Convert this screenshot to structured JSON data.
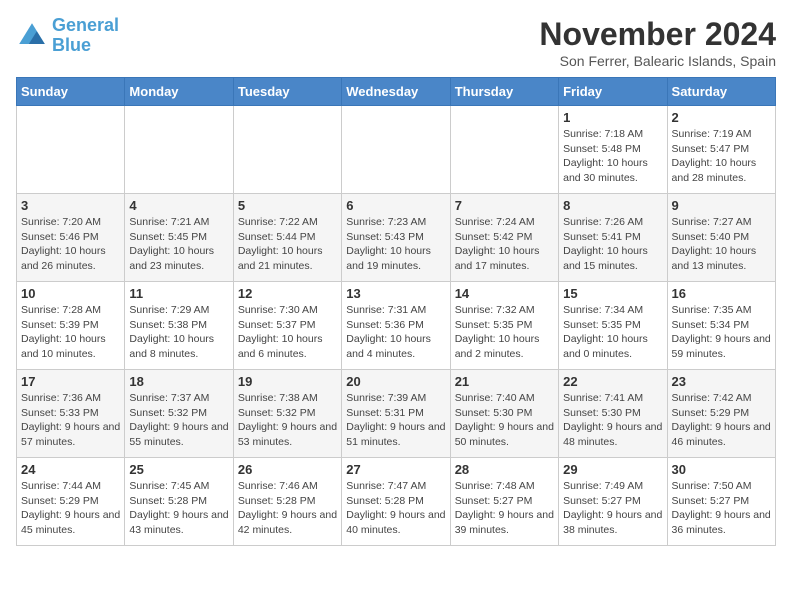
{
  "header": {
    "logo_general": "General",
    "logo_blue": "Blue",
    "month_title": "November 2024",
    "location": "Son Ferrer, Balearic Islands, Spain"
  },
  "days_of_week": [
    "Sunday",
    "Monday",
    "Tuesday",
    "Wednesday",
    "Thursday",
    "Friday",
    "Saturday"
  ],
  "weeks": [
    [
      {
        "day": "",
        "info": ""
      },
      {
        "day": "",
        "info": ""
      },
      {
        "day": "",
        "info": ""
      },
      {
        "day": "",
        "info": ""
      },
      {
        "day": "",
        "info": ""
      },
      {
        "day": "1",
        "info": "Sunrise: 7:18 AM\nSunset: 5:48 PM\nDaylight: 10 hours and 30 minutes."
      },
      {
        "day": "2",
        "info": "Sunrise: 7:19 AM\nSunset: 5:47 PM\nDaylight: 10 hours and 28 minutes."
      }
    ],
    [
      {
        "day": "3",
        "info": "Sunrise: 7:20 AM\nSunset: 5:46 PM\nDaylight: 10 hours and 26 minutes."
      },
      {
        "day": "4",
        "info": "Sunrise: 7:21 AM\nSunset: 5:45 PM\nDaylight: 10 hours and 23 minutes."
      },
      {
        "day": "5",
        "info": "Sunrise: 7:22 AM\nSunset: 5:44 PM\nDaylight: 10 hours and 21 minutes."
      },
      {
        "day": "6",
        "info": "Sunrise: 7:23 AM\nSunset: 5:43 PM\nDaylight: 10 hours and 19 minutes."
      },
      {
        "day": "7",
        "info": "Sunrise: 7:24 AM\nSunset: 5:42 PM\nDaylight: 10 hours and 17 minutes."
      },
      {
        "day": "8",
        "info": "Sunrise: 7:26 AM\nSunset: 5:41 PM\nDaylight: 10 hours and 15 minutes."
      },
      {
        "day": "9",
        "info": "Sunrise: 7:27 AM\nSunset: 5:40 PM\nDaylight: 10 hours and 13 minutes."
      }
    ],
    [
      {
        "day": "10",
        "info": "Sunrise: 7:28 AM\nSunset: 5:39 PM\nDaylight: 10 hours and 10 minutes."
      },
      {
        "day": "11",
        "info": "Sunrise: 7:29 AM\nSunset: 5:38 PM\nDaylight: 10 hours and 8 minutes."
      },
      {
        "day": "12",
        "info": "Sunrise: 7:30 AM\nSunset: 5:37 PM\nDaylight: 10 hours and 6 minutes."
      },
      {
        "day": "13",
        "info": "Sunrise: 7:31 AM\nSunset: 5:36 PM\nDaylight: 10 hours and 4 minutes."
      },
      {
        "day": "14",
        "info": "Sunrise: 7:32 AM\nSunset: 5:35 PM\nDaylight: 10 hours and 2 minutes."
      },
      {
        "day": "15",
        "info": "Sunrise: 7:34 AM\nSunset: 5:35 PM\nDaylight: 10 hours and 0 minutes."
      },
      {
        "day": "16",
        "info": "Sunrise: 7:35 AM\nSunset: 5:34 PM\nDaylight: 9 hours and 59 minutes."
      }
    ],
    [
      {
        "day": "17",
        "info": "Sunrise: 7:36 AM\nSunset: 5:33 PM\nDaylight: 9 hours and 57 minutes."
      },
      {
        "day": "18",
        "info": "Sunrise: 7:37 AM\nSunset: 5:32 PM\nDaylight: 9 hours and 55 minutes."
      },
      {
        "day": "19",
        "info": "Sunrise: 7:38 AM\nSunset: 5:32 PM\nDaylight: 9 hours and 53 minutes."
      },
      {
        "day": "20",
        "info": "Sunrise: 7:39 AM\nSunset: 5:31 PM\nDaylight: 9 hours and 51 minutes."
      },
      {
        "day": "21",
        "info": "Sunrise: 7:40 AM\nSunset: 5:30 PM\nDaylight: 9 hours and 50 minutes."
      },
      {
        "day": "22",
        "info": "Sunrise: 7:41 AM\nSunset: 5:30 PM\nDaylight: 9 hours and 48 minutes."
      },
      {
        "day": "23",
        "info": "Sunrise: 7:42 AM\nSunset: 5:29 PM\nDaylight: 9 hours and 46 minutes."
      }
    ],
    [
      {
        "day": "24",
        "info": "Sunrise: 7:44 AM\nSunset: 5:29 PM\nDaylight: 9 hours and 45 minutes."
      },
      {
        "day": "25",
        "info": "Sunrise: 7:45 AM\nSunset: 5:28 PM\nDaylight: 9 hours and 43 minutes."
      },
      {
        "day": "26",
        "info": "Sunrise: 7:46 AM\nSunset: 5:28 PM\nDaylight: 9 hours and 42 minutes."
      },
      {
        "day": "27",
        "info": "Sunrise: 7:47 AM\nSunset: 5:28 PM\nDaylight: 9 hours and 40 minutes."
      },
      {
        "day": "28",
        "info": "Sunrise: 7:48 AM\nSunset: 5:27 PM\nDaylight: 9 hours and 39 minutes."
      },
      {
        "day": "29",
        "info": "Sunrise: 7:49 AM\nSunset: 5:27 PM\nDaylight: 9 hours and 38 minutes."
      },
      {
        "day": "30",
        "info": "Sunrise: 7:50 AM\nSunset: 5:27 PM\nDaylight: 9 hours and 36 minutes."
      }
    ]
  ]
}
